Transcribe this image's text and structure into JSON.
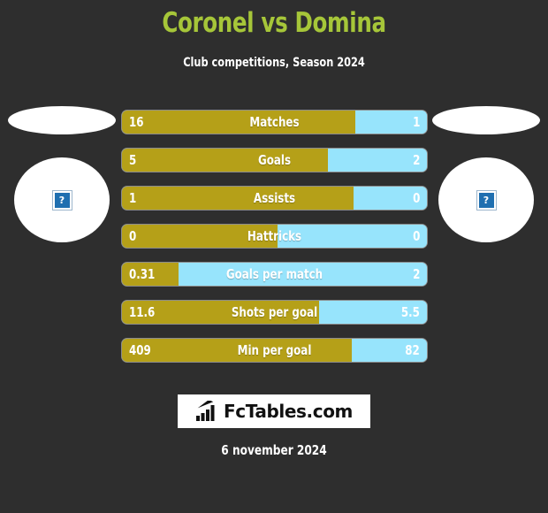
{
  "header": {
    "title": "Coronel vs Domina",
    "subtitle": "Club competitions, Season 2024",
    "title_color": "#a6c639"
  },
  "crests": {
    "home": {
      "placeholder_glyph": "?",
      "alt": "broken-image"
    },
    "away": {
      "placeholder_glyph": "?",
      "alt": "broken-image"
    }
  },
  "colors": {
    "background": "#2e2e2e",
    "home_bar": "#b5a018",
    "away_bar": "#97e4fc",
    "text": "#ffffff"
  },
  "chart_data": {
    "type": "bar",
    "title": "Coronel vs Domina",
    "subtitle": "Club competitions, Season 2024",
    "orientation": "horizontal-diverging",
    "categories": [
      "Matches",
      "Goals",
      "Assists",
      "Hattricks",
      "Goals per match",
      "Shots per goal",
      "Min per goal"
    ],
    "series": [
      {
        "name": "Coronel",
        "color": "#b5a018",
        "values": [
          "16",
          "5",
          "1",
          "0",
          "0.31",
          "11.6",
          "409"
        ]
      },
      {
        "name": "Domina",
        "color": "#97e4fc",
        "values": [
          "1",
          "2",
          "0",
          "0",
          "2",
          "5.5",
          "82"
        ]
      }
    ],
    "home_share_pct": [
      76.5,
      67.5,
      76.0,
      51.0,
      18.5,
      64.5,
      75.5
    ]
  },
  "rows": [
    {
      "label": "Matches",
      "home": "16",
      "away": "1",
      "home_pct": 76.5
    },
    {
      "label": "Goals",
      "home": "5",
      "away": "2",
      "home_pct": 67.5
    },
    {
      "label": "Assists",
      "home": "1",
      "away": "0",
      "home_pct": 76.0
    },
    {
      "label": "Hattricks",
      "home": "0",
      "away": "0",
      "home_pct": 51.0
    },
    {
      "label": "Goals per match",
      "home": "0.31",
      "away": "2",
      "home_pct": 18.5
    },
    {
      "label": "Shots per goal",
      "home": "11.6",
      "away": "5.5",
      "home_pct": 64.5
    },
    {
      "label": "Min per goal",
      "home": "409",
      "away": "82",
      "home_pct": 75.5
    }
  ],
  "footer": {
    "logo_text": "FcTables.com",
    "logo_icon": "bar-chart-arrow-icon",
    "date": "6 november 2024"
  }
}
